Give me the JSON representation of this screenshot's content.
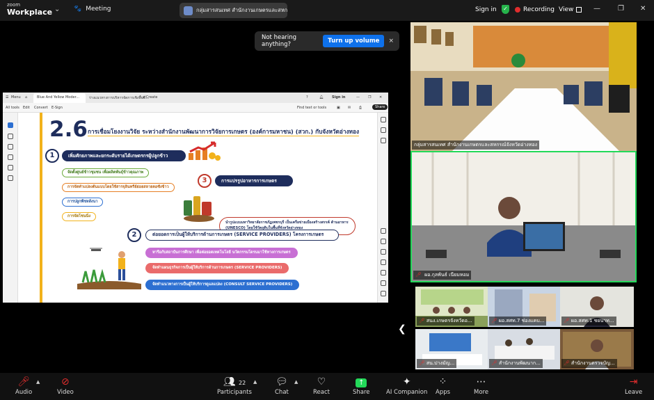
{
  "topbar": {
    "brand_small": "zoom",
    "brand_big": "Workplace",
    "meeting_label": "Meeting",
    "meeting_name": "กลุ่มสารสนเทศ สำนักงานเกษตรและสหกรณ์",
    "sign_in": "Sign in",
    "recording": "Recording",
    "view": "View"
  },
  "toast": {
    "message": "Not hearing anything?",
    "button": "Turn up volume",
    "close": "×"
  },
  "acrobat": {
    "menu": "Menu",
    "tab1": "Blue And Yellow Moder...",
    "tab2": "ร่างแนวทางการบริหารจัดการเชิงพื้นที่...",
    "create": "+ Create",
    "sign_in": "Sign in",
    "tools": [
      "All tools",
      "Edit",
      "Convert",
      "E-Sign"
    ],
    "find": "Find text or tools",
    "share": "Share"
  },
  "slide": {
    "number": "2.6",
    "title": "การเชื่อมโยงงานวิจัย ระหว่างสำนักงานพัฒนาการวิจัยการเกษตร (องค์การมหาชน) (สวก.) กับจังหวัดอ่างทอง",
    "s1_num": "1",
    "s1_title": "เพิ่มศักยภาพและยกระดับรายได้เกษตรกรผู้ปลูกข้าว",
    "s1_items": [
      "จัดตั้งศูนย์ข้าวชุมชน เพื่อผลิตพันธุ์ข้าวคุณภาพ",
      "การจัดทำแปลงต้นแบบโดยใช้สารจุลินทรีย์ย่อยสลายตอซังข้าว",
      "การปลูกพืชหลังนา",
      "การจัดโซนนิ่ง"
    ],
    "s2_num": "2",
    "s2_title": "ต่อยอดการเป็นผู้ให้บริการด้านการเกษตร (SERVICE PROVIDERS) โครงการเกษตร",
    "s2_items": [
      "หารือกับสถาบันการศึกษา เพื่อต่อยอดเทคโนโลยี นวัตกรรมโดรนมาใช้ทางการเกษตร",
      "จัดทำแผนธุรกิจการเป็นผู้ให้บริการด้านการเกษตร (SERVICE PROVIDERS)",
      "จัดทำแนวทางการเป็นผู้ให้บริการดูแลแปลง (CONSULT SERVICE PROVIDERS)"
    ],
    "s3_num": "3",
    "s3_title": "การแปรรูปอาหารการเกษตร",
    "s3_desc": "นำรูปแบบมหาวิทยาลัยราชภัฏเพชรบุรี เป็นเครือข่ายเมืองสร้างสรรค์ ด้านอาหาร (UNESCO) โดยใช้วัตถุดิบในพื้นที่จังหวัดอ่างทอง",
    "colors": {
      "navy": "#1e2d5c",
      "yellow": "#f2b21b",
      "magenta": "#c86fd4",
      "salmon": "#ea6b6b",
      "blue": "#2c6fd1"
    }
  },
  "speakers": [
    {
      "name": "กลุ่มสารสนเทศ สำนักงานเกษตรและสหกรณ์จังหวัดอ่างทอง"
    },
    {
      "name": "ผอ.กุลพันธ์ เนียมหอม"
    }
  ],
  "gallery": [
    {
      "name": "สนง.เกษตรจังหวัดอ..."
    },
    {
      "name": "ผอ.สศท.7 ช่องแคบ..."
    },
    {
      "name": "ผอ.สศท.1 ชยนาท..."
    },
    {
      "name": "สน.ปางมัญ..."
    },
    {
      "name": "สำนักงานพัฒนาก..."
    },
    {
      "name": "สำนักงานตรวจบัญ..."
    }
  ],
  "bottombar": {
    "audio": "Audio",
    "video": "Video",
    "participants": "Participants",
    "participants_count": "22",
    "chat": "Chat",
    "react": "React",
    "share": "Share",
    "ai": "AI Companion",
    "apps": "Apps",
    "more": "More",
    "leave": "Leave"
  }
}
